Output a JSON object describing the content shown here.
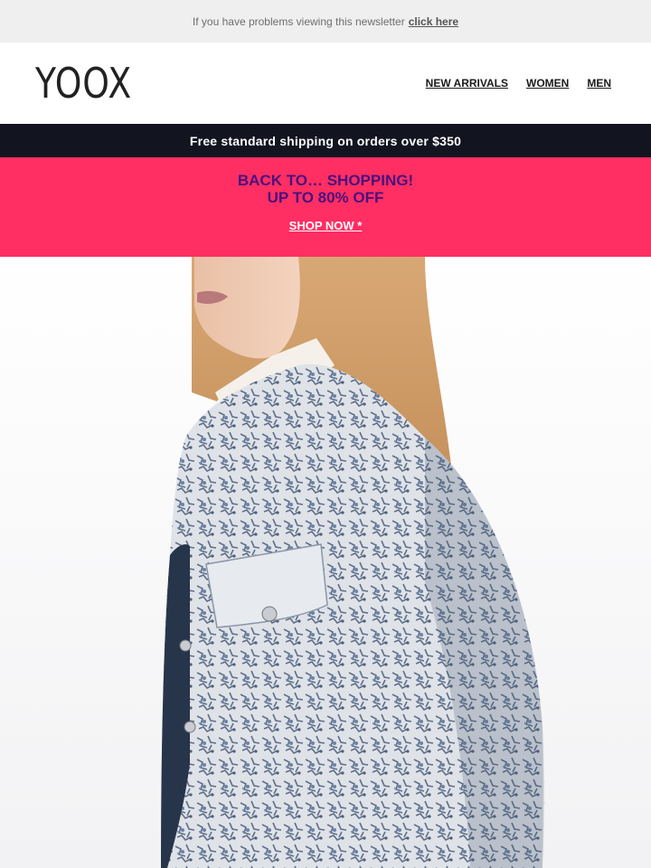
{
  "preheader": {
    "text": "If you have problems viewing this newsletter",
    "link": "click here"
  },
  "header": {
    "logo": "YOOX",
    "nav": [
      {
        "label": "NEW ARRIVALS"
      },
      {
        "label": "WOMEN"
      },
      {
        "label": "MEN"
      }
    ]
  },
  "shipping_bar": {
    "text": "Free standard shipping on orders over $350"
  },
  "promo": {
    "line1": "BACK TO… SHOPPING!",
    "line2": "UP TO 80% OFF",
    "cta": "SHOP NOW *",
    "background": "#ff2e63",
    "text_color": "#4b117e"
  },
  "hero": {
    "image": "model-in-crackle-denim-jacket"
  }
}
